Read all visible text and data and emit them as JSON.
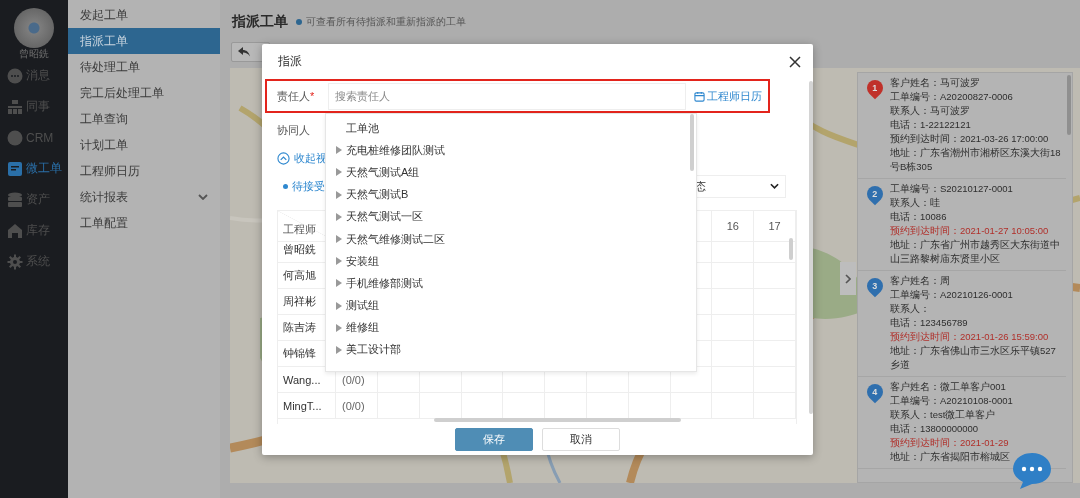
{
  "nav": {
    "user": {
      "name": "曾昭銑"
    },
    "items": [
      {
        "label": "消息",
        "kind": "chat",
        "selected": false
      },
      {
        "label": "同事",
        "kind": "org",
        "selected": false
      },
      {
        "label": "CRM",
        "kind": "crm",
        "selected": false
      },
      {
        "label": "微工单",
        "kind": "ticket",
        "selected": true
      },
      {
        "label": "资产",
        "kind": "asset",
        "selected": false
      },
      {
        "label": "库存",
        "kind": "store",
        "selected": false
      },
      {
        "label": "系统",
        "kind": "gear",
        "selected": false
      }
    ]
  },
  "submenu": [
    {
      "label": "发起工单",
      "kind": "link",
      "selected": false
    },
    {
      "label": "指派工单",
      "kind": "link",
      "selected": true
    },
    {
      "label": "待处理工单",
      "kind": "link",
      "selected": false
    },
    {
      "label": "完工后处理工单",
      "kind": "link",
      "selected": false
    },
    {
      "label": "工单查询",
      "kind": "link",
      "selected": false
    },
    {
      "label": "计划工单",
      "kind": "link",
      "selected": false
    },
    {
      "label": "工程师日历",
      "kind": "link",
      "selected": false
    },
    {
      "label": "统计报表",
      "kind": "group",
      "selected": false,
      "expanded": false
    },
    {
      "label": "工单配置",
      "kind": "link",
      "selected": false
    }
  ],
  "page": {
    "title": "指派工单",
    "hint": "可查看所有待指派和重新指派的工单"
  },
  "orders": [
    {
      "pin": "1",
      "color": "#c0312a",
      "lines": [
        {
          "text": "客户姓名：马可波罗",
          "alert": false
        },
        {
          "text": "工单编号：A20200827-0006",
          "alert": false
        },
        {
          "text": "联系人：马可波罗",
          "alert": false
        },
        {
          "text": "电话：1-22122121",
          "alert": false
        },
        {
          "text": "预约到达时间：2021-03-26 17:00:00",
          "alert": false
        },
        {
          "text": "地址：广东省潮州市湘桥区东溪大街18号B栋305",
          "alert": false
        }
      ]
    },
    {
      "pin": "2",
      "color": "#2f6fae",
      "lines": [
        {
          "text": "工单编号：S20210127-0001",
          "alert": false
        },
        {
          "text": "联系人：哇",
          "alert": false
        },
        {
          "text": "电话：10086",
          "alert": false
        },
        {
          "text": "预约到达时间：2021-01-27 10:05:00",
          "alert": true
        },
        {
          "text": "地址：广东省广州市越秀区大东街道中山三路黎树庙东贤里小区",
          "alert": false
        }
      ]
    },
    {
      "pin": "3",
      "color": "#2f6fae",
      "lines": [
        {
          "text": "客户姓名：周",
          "alert": false
        },
        {
          "text": "工单编号：A20210126-0001",
          "alert": false
        },
        {
          "text": "联系人：",
          "alert": false
        },
        {
          "text": "电话：123456789",
          "alert": false
        },
        {
          "text": "预约到达时间：2021-01-26 15:59:00",
          "alert": true
        },
        {
          "text": "地址：广东省佛山市三水区乐平镇527乡道",
          "alert": false
        }
      ]
    },
    {
      "pin": "4",
      "color": "#2f6fae",
      "lines": [
        {
          "text": "客户姓名：微工单客户001",
          "alert": false
        },
        {
          "text": "工单编号：A20210108-0001",
          "alert": false
        },
        {
          "text": "联系人：test微工单客户",
          "alert": false
        },
        {
          "text": "电话：13800000000",
          "alert": false
        },
        {
          "text": "预约到达时间：2021-01-29",
          "alert": true
        },
        {
          "text": "地址：广东省揭阳市榕城区",
          "alert": false
        }
      ]
    }
  ],
  "dialog": {
    "title": "指派",
    "owner": {
      "label": "责任人",
      "required_mark": "*",
      "placeholder": "搜索责任人",
      "calendar_link": "工程师日历"
    },
    "assistant_label": "协同人",
    "collapse_link": "收起视",
    "status_filter": "待接受",
    "status_select": "态",
    "team_dropdown": [
      {
        "label": "工单池",
        "kind": "leaf"
      },
      {
        "label": "充电桩维修团队测试",
        "kind": "group",
        "expanded": false
      },
      {
        "label": "天然气测试A组",
        "kind": "group",
        "expanded": false
      },
      {
        "label": "天然气测试B",
        "kind": "group",
        "expanded": false
      },
      {
        "label": "天然气测试一区",
        "kind": "group",
        "expanded": false
      },
      {
        "label": "天然气维修测试二区",
        "kind": "group",
        "expanded": false
      },
      {
        "label": "安装组",
        "kind": "group",
        "expanded": false
      },
      {
        "label": "手机维修部测试",
        "kind": "group",
        "expanded": false
      },
      {
        "label": "测试组",
        "kind": "group",
        "expanded": false
      },
      {
        "label": "维修组",
        "kind": "group",
        "expanded": false
      },
      {
        "label": "美工设计部",
        "kind": "group",
        "expanded": false
      }
    ],
    "schedule": {
      "corner": "工程师",
      "hours": [
        "16",
        "17"
      ],
      "rows": [
        {
          "name": "曾昭銑"
        },
        {
          "name": "何高旭"
        },
        {
          "name": "周祥彬"
        },
        {
          "name": "陈吉涛"
        },
        {
          "name": "钟锦锋"
        },
        {
          "name": "Wang...",
          "count": "(0/0)"
        },
        {
          "name": "MingT...",
          "count": "(0/0)"
        }
      ]
    },
    "buttons": [
      {
        "label": "保存",
        "kind": "primary"
      },
      {
        "label": "取消",
        "kind": "default"
      }
    ]
  }
}
